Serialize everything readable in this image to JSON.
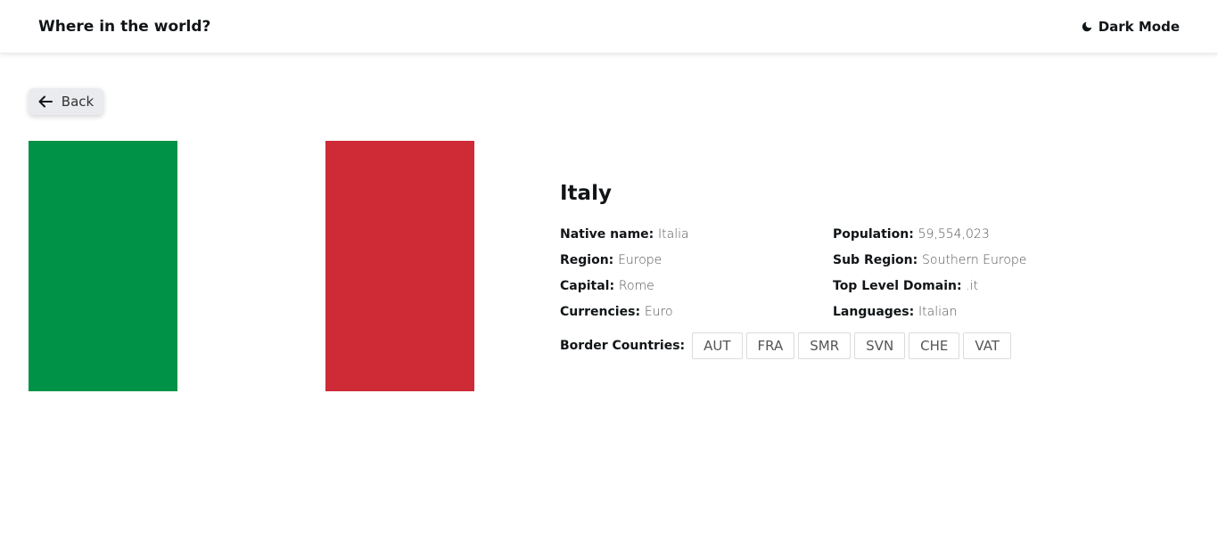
{
  "header": {
    "title": "Where in the world?",
    "theme_toggle": {
      "label": "Dark Mode",
      "icon": "moon-icon"
    }
  },
  "back_button": {
    "label": "Back",
    "icon": "arrow-left-icon"
  },
  "flag": {
    "country": "Italy",
    "colors": [
      "#009246",
      "#ffffff",
      "#ce2b37"
    ]
  },
  "country": {
    "name": "Italy",
    "left_column": [
      {
        "label": "Native name:",
        "value": "Italia"
      },
      {
        "label": "Region:",
        "value": "Europe"
      },
      {
        "label": "Capital:",
        "value": "Rome"
      },
      {
        "label": "Currencies:",
        "value": "Euro"
      }
    ],
    "right_column": [
      {
        "label": "Population:",
        "value": "59,554,023"
      },
      {
        "label": "Sub Region:",
        "value": "Southern Europe"
      },
      {
        "label": "Top Level Domain:",
        "value": ".it"
      },
      {
        "label": "Languages:",
        "value": "Italian"
      }
    ],
    "border_label": "Border Countries:",
    "borders": [
      "AUT",
      "FRA",
      "SMR",
      "SVN",
      "CHE",
      "VAT"
    ]
  }
}
